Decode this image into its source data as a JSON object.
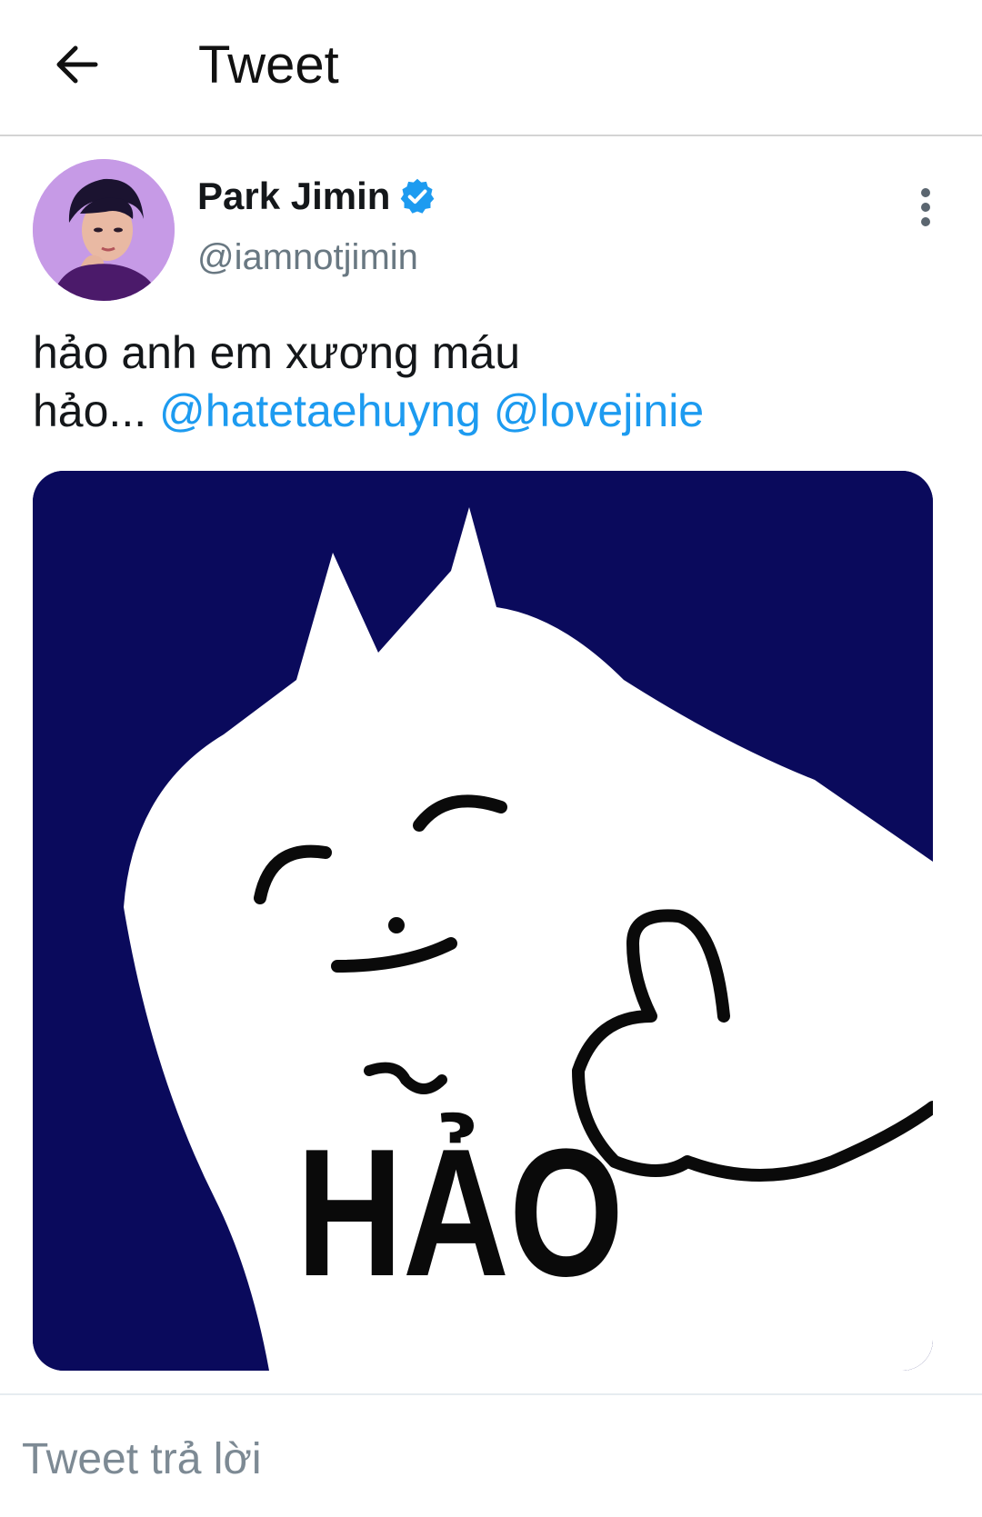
{
  "header": {
    "title": "Tweet",
    "back_icon": "arrow-left-icon"
  },
  "tweet": {
    "author": {
      "display_name": "Park Jimin",
      "handle": "@iamnotjimin",
      "verified": true,
      "verified_color": "#1d9bf0"
    },
    "text_line1": "hảo anh em xương máu",
    "text_line2_prefix": "hảo...",
    "mentions": [
      "@hatetaehuyng",
      "@lovejinie"
    ],
    "mention_color": "#1d9bf0",
    "more_icon": "vertical-ellipsis-icon",
    "media": {
      "kind": "meme-image",
      "caption_text": "HẢO",
      "background_color": "#0a0a5c"
    }
  },
  "reply": {
    "placeholder": "Tweet trả lời"
  }
}
